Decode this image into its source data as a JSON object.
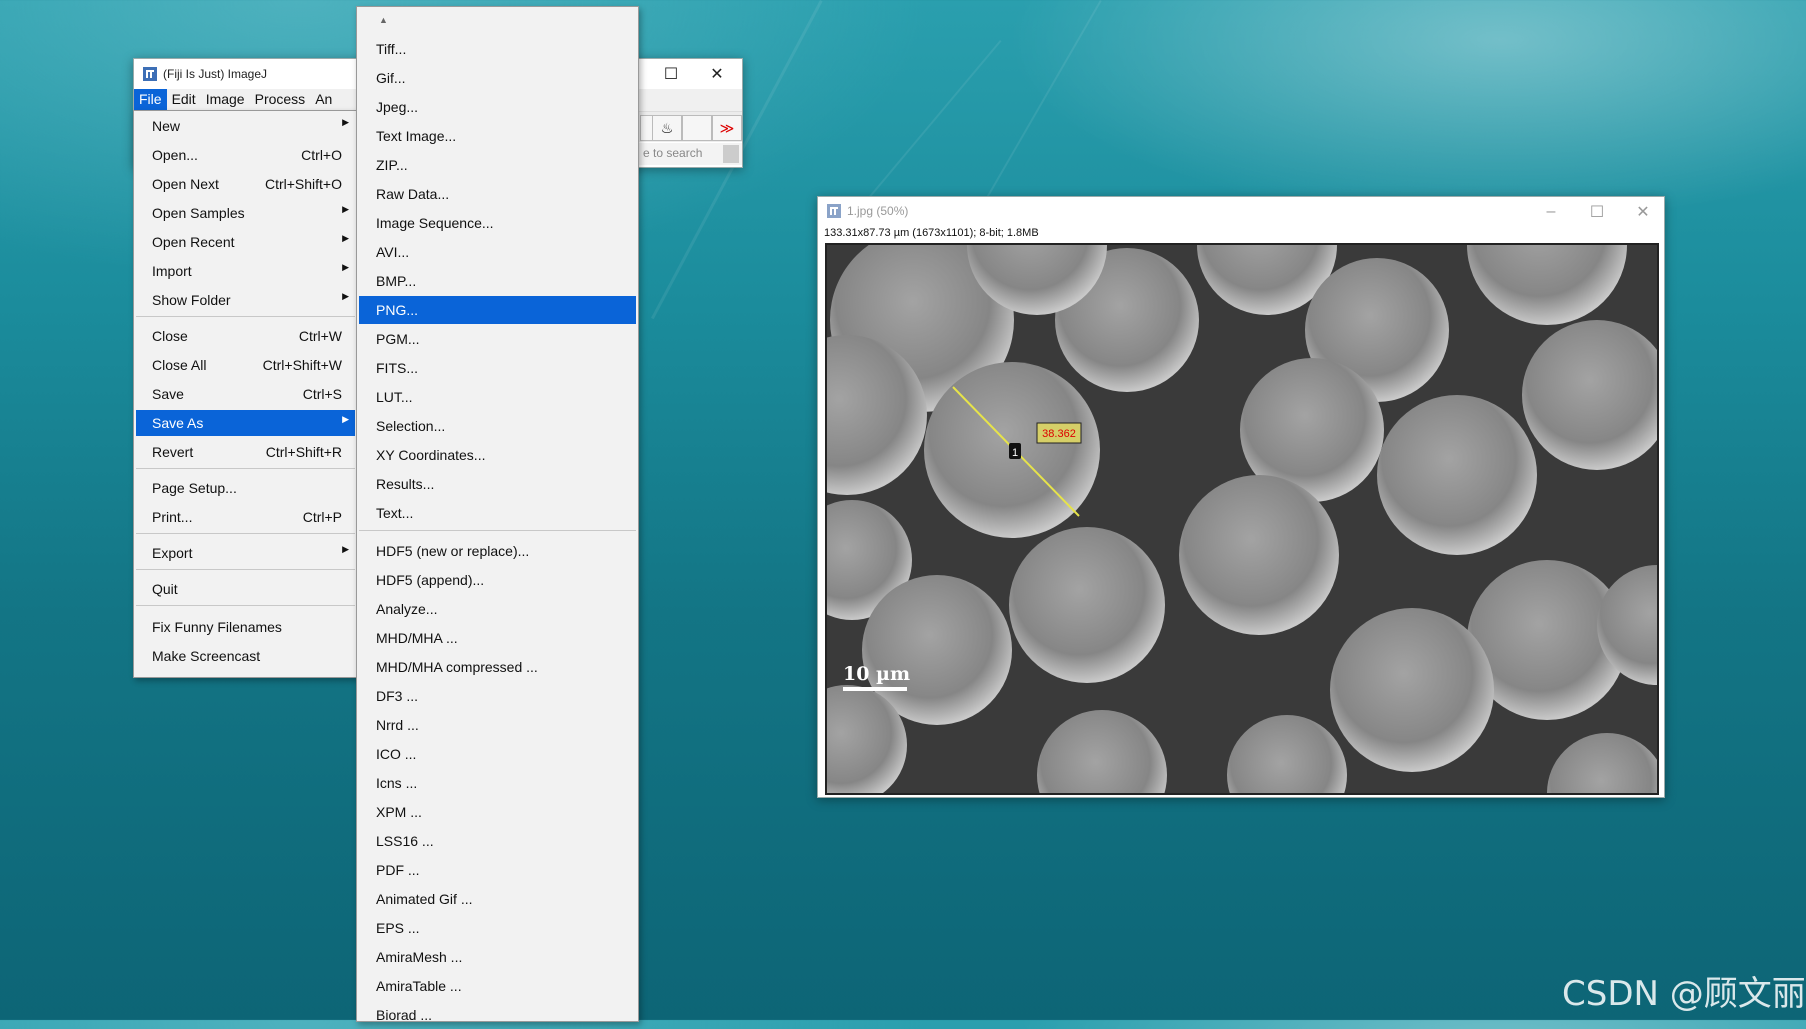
{
  "fiji": {
    "title": "(Fiji Is Just) ImageJ",
    "menu": [
      "File",
      "Edit",
      "Image",
      "Process",
      "An"
    ],
    "search_placeholder": "e to search"
  },
  "file_menu": {
    "items": [
      {
        "label": "New",
        "shortcut": "",
        "submenu": true
      },
      {
        "label": "Open...",
        "shortcut": "Ctrl+O",
        "submenu": false
      },
      {
        "label": "Open Next",
        "shortcut": "Ctrl+Shift+O",
        "submenu": false
      },
      {
        "label": "Open Samples",
        "shortcut": "",
        "submenu": true
      },
      {
        "label": "Open Recent",
        "shortcut": "",
        "submenu": true
      },
      {
        "label": "Import",
        "shortcut": "",
        "submenu": true
      },
      {
        "label": "Show Folder",
        "shortcut": "",
        "submenu": true
      },
      {
        "label": "Close",
        "shortcut": "Ctrl+W",
        "submenu": false
      },
      {
        "label": "Close All",
        "shortcut": "Ctrl+Shift+W",
        "submenu": false
      },
      {
        "label": "Save",
        "shortcut": "Ctrl+S",
        "submenu": false
      },
      {
        "label": "Save As",
        "shortcut": "",
        "submenu": true
      },
      {
        "label": "Revert",
        "shortcut": "Ctrl+Shift+R",
        "submenu": false
      },
      {
        "label": "Page Setup...",
        "shortcut": "",
        "submenu": false
      },
      {
        "label": "Print...",
        "shortcut": "Ctrl+P",
        "submenu": false
      },
      {
        "label": "Export",
        "shortcut": "",
        "submenu": true
      },
      {
        "label": "Quit",
        "shortcut": "",
        "submenu": false
      },
      {
        "label": "Fix Funny Filenames",
        "shortcut": "",
        "submenu": false
      },
      {
        "label": "Make Screencast",
        "shortcut": "",
        "submenu": false
      }
    ],
    "highlighted": "Save As"
  },
  "save_as_menu": {
    "items": [
      "Tiff...",
      "Gif...",
      "Jpeg...",
      "Text Image...",
      "ZIP...",
      "Raw Data...",
      "Image Sequence...",
      "AVI...",
      "BMP...",
      "PNG...",
      "PGM...",
      "FITS...",
      "LUT...",
      "Selection...",
      "XY Coordinates...",
      "Results...",
      "Text...",
      "HDF5 (new or replace)...",
      "HDF5 (append)...",
      "Analyze...",
      "MHD/MHA ...",
      "MHD/MHA compressed ...",
      "DF3 ...",
      "Nrrd ...",
      "ICO ...",
      "Icns ...",
      "XPM ...",
      "LSS16 ...",
      "PDF ...",
      "Animated Gif ...",
      "EPS ...",
      "AmiraMesh ...",
      "AmiraTable ...",
      "Biorad ..."
    ],
    "highlighted": "PNG..."
  },
  "image_window": {
    "title": "1.jpg (50%)",
    "info": "133.31x87.73 µm (1673x1101); 8-bit; 1.8MB",
    "scale_bar_label": "10 µm",
    "line_label": "1",
    "measurement_label": "38.362"
  },
  "watermark": "CSDN @顾文丽"
}
